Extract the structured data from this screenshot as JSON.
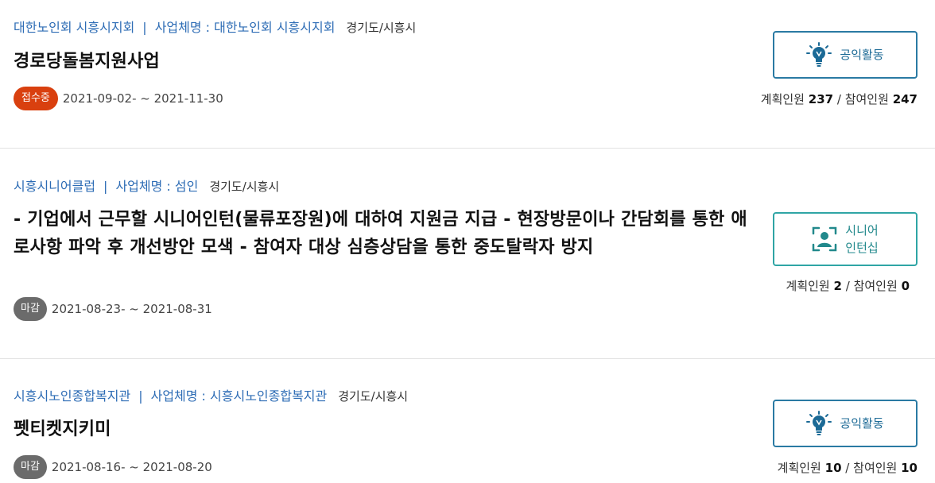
{
  "items": [
    {
      "org": "대한노인회 시흥시지회",
      "separator": "|",
      "operator": "사업체명 : 대한노인회 시흥시지회",
      "region": "경기도/시흥시",
      "title": "경로당돌봄지원사업",
      "status": "접수중",
      "dates": "2021-09-02- ~ 2021-11-30",
      "category": "공익활동",
      "category_icon": "lightbulb-icon",
      "planned_label": "계획인원",
      "planned": "237",
      "slash": "/",
      "participants_label": "참여인원",
      "participants": "247"
    },
    {
      "org": "시흥시니어클럽",
      "separator": "|",
      "operator": "사업체명 : 섬인",
      "region": "경기도/시흥시",
      "title": "- 기업에서 근무할 시니어인턴(물류포장원)에 대하여 지원금 지급 - 현장방문이나 간담회를 통한 애로사항 파악 후 개선방안 모색 - 참여자 대상 심층상담을 통한 중도탈락자 방지",
      "status": "마감",
      "dates": "2021-08-23- ~ 2021-08-31",
      "category_line1": "시니어",
      "category_line2": "인턴십",
      "category_icon": "person-frame-icon",
      "planned_label": "계획인원",
      "planned": "2",
      "slash": "/",
      "participants_label": "참여인원",
      "participants": "0"
    },
    {
      "org": "시흥시노인종합복지관",
      "separator": "|",
      "operator": "사업체명 : 시흥시노인종합복지관",
      "region": "경기도/시흥시",
      "title": "펫티켓지키미",
      "status": "마감",
      "dates": "2021-08-16- ~ 2021-08-20",
      "category": "공익활동",
      "category_icon": "lightbulb-icon",
      "planned_label": "계획인원",
      "planned": "10",
      "slash": "/",
      "participants_label": "참여인원",
      "participants": "10"
    }
  ],
  "colors": {
    "status_open": "#d9400f",
    "status_closed": "#6b6b6b",
    "link_blue": "#2d6cb5",
    "public_btn": "#2a7aa3",
    "intern_btn": "#2fa5a5"
  }
}
